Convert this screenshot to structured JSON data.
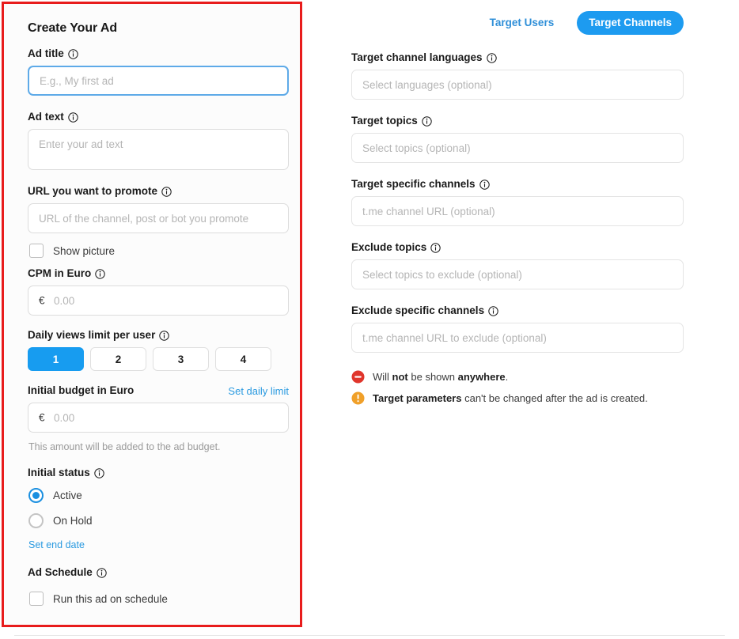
{
  "left": {
    "title": "Create Your Ad",
    "ad_title": {
      "label": "Ad title",
      "placeholder": "E.g., My first ad",
      "value": ""
    },
    "ad_text": {
      "label": "Ad text",
      "placeholder": "Enter your ad text",
      "value": ""
    },
    "url": {
      "label": "URL you want to promote",
      "placeholder": "URL of the channel, post or bot you promote",
      "value": ""
    },
    "show_picture": {
      "label": "Show picture",
      "checked": false
    },
    "cpm": {
      "label": "CPM in Euro",
      "currency": "€",
      "placeholder": "0.00",
      "value": ""
    },
    "daily_views": {
      "label": "Daily views limit per user",
      "options": [
        "1",
        "2",
        "3",
        "4"
      ],
      "selected": "1"
    },
    "initial_budget": {
      "label": "Initial budget in Euro",
      "link": "Set daily limit",
      "currency": "€",
      "placeholder": "0.00",
      "value": "",
      "hint": "This amount will be added to the ad budget."
    },
    "initial_status": {
      "label": "Initial status",
      "options": [
        "Active",
        "On Hold"
      ],
      "selected": "Active",
      "link": "Set end date"
    },
    "ad_schedule": {
      "label": "Ad Schedule",
      "checkbox_label": "Run this ad on schedule",
      "checked": false
    }
  },
  "right": {
    "tabs": [
      {
        "label": "Target Users",
        "active": false
      },
      {
        "label": "Target Channels",
        "active": true
      }
    ],
    "fields": [
      {
        "label": "Target channel languages",
        "placeholder": "Select languages (optional)",
        "value": ""
      },
      {
        "label": "Target topics",
        "placeholder": "Select topics (optional)",
        "value": ""
      },
      {
        "label": "Target specific channels",
        "placeholder": "t.me channel URL (optional)",
        "value": ""
      },
      {
        "label": "Exclude topics",
        "placeholder": "Select topics to exclude (optional)",
        "value": ""
      },
      {
        "label": "Exclude specific channels",
        "placeholder": "t.me channel URL to exclude (optional)",
        "value": ""
      }
    ],
    "notes": [
      {
        "icon": "minus-circle-icon",
        "prefix": "Will ",
        "bold1": "not",
        "middle": " be shown ",
        "bold2": "anywhere",
        "suffix": "."
      },
      {
        "icon": "exclamation-circle-icon",
        "prefix": "",
        "bold1": "Target parameters",
        "middle": " can't be changed after the ad is created.",
        "bold2": "",
        "suffix": ""
      }
    ]
  },
  "colors": {
    "accent_blue": "#1d9bf0",
    "link_blue": "#2a9ae0",
    "highlight_red": "#e81c1c",
    "note_red": "#e0352b",
    "note_orange": "#f0a029"
  }
}
